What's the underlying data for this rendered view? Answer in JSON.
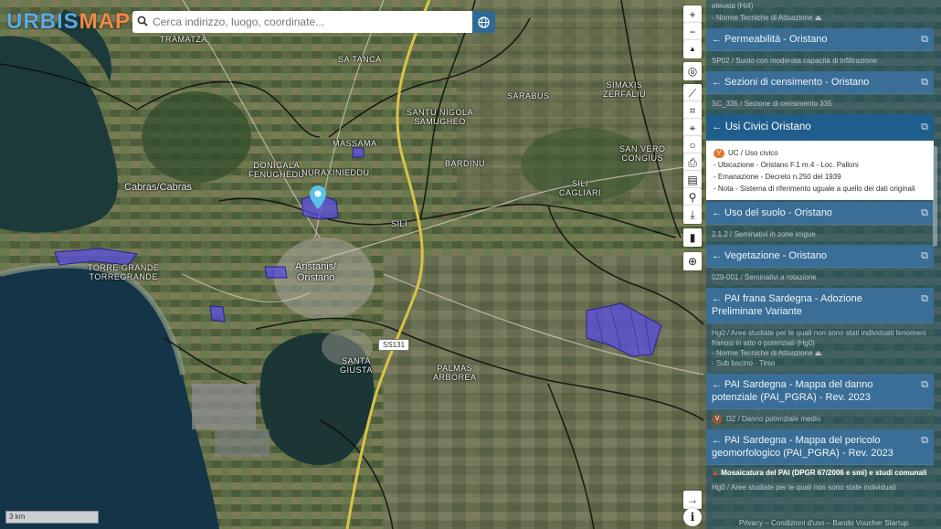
{
  "logo": {
    "part1": "URBIS",
    "part2": "MAP"
  },
  "search": {
    "placeholder": "Cerca indirizzo, luogo, coordinate..."
  },
  "map": {
    "labels": [
      {
        "id": "tabaccheria",
        "text": "TRAMATZA"
      },
      {
        "id": "sa-tanca",
        "text": "SA TANCA"
      },
      {
        "id": "massama",
        "text": "MASSAMA"
      },
      {
        "id": "donigala",
        "text": "DONIGALA\nFENUGHEDU"
      },
      {
        "id": "nuraxinieddu",
        "text": "NURAXINIEDDU"
      },
      {
        "id": "sarabus",
        "text": "SARABUS"
      },
      {
        "id": "simaxis",
        "text": "SIMAXIS\nZERFALIU"
      },
      {
        "id": "santu-nigola",
        "text": "SANTU NIGOLA\nSAMUGHEO"
      },
      {
        "id": "bardinu",
        "text": "BARDINU"
      },
      {
        "id": "san-vero",
        "text": "SAN VERO\nCONGIUS"
      },
      {
        "id": "solarussa",
        "text": "SILI\nCAGLIARI"
      },
      {
        "id": "silì",
        "text": "SILÌ"
      },
      {
        "id": "cabras",
        "text": "Cabras/Cabras"
      },
      {
        "id": "torre-grande",
        "text": "TORRE GRANDE\nTORREGRANDE"
      },
      {
        "id": "oristano",
        "text": "Aristanis/\nOristano"
      },
      {
        "id": "santa-giusta",
        "text": "SANTA\nGIUSTA"
      },
      {
        "id": "palmas",
        "text": "PALMAS\nARBOREA"
      }
    ],
    "road_badge": "SS131",
    "scale": "3 km"
  },
  "toolbar": {
    "zoom_in": "+",
    "zoom_out": "−",
    "north": "▲",
    "locate": "◎",
    "ruler": "⟋",
    "area": "⌗",
    "marker": "⌖",
    "circle": "○",
    "print": "⎙",
    "layers": "▤",
    "pin": "⚲",
    "download": "⤓",
    "bookmark": "▮",
    "language": "⊕",
    "collapse": "→",
    "info": "i"
  },
  "panel": {
    "top_text": "elevata (Hi4)",
    "top_note": "- Norme Tecniche di Attuazione",
    "sections": [
      {
        "id": "permeabilita",
        "title": "← Permeabilità - Oristano",
        "body": "SP02 / Suolo con moderata capacità di infiltrazione"
      },
      {
        "id": "censimento",
        "title": "← Sezioni di censimento - Oristano",
        "body": "SC_335 / Sezione di censimento 335"
      },
      {
        "id": "usi-civici",
        "title": "← Usi Civici Oristano",
        "badge": "V",
        "head_line": "UC / Uso civico",
        "rows": [
          "- Ubicazione - Oristano F.1 m.4 - Loc. Palloni",
          "- Emanazione - Decreto n.250 del 1939",
          "- Nota - Sistema di riferimento uguale a quello dei dati originali"
        ]
      },
      {
        "id": "uso-suolo",
        "title": "← Uso del suolo - Oristano",
        "body": "2.1.2 / Seminativi in zone irrigue"
      },
      {
        "id": "vegetazione",
        "title": "← Vegetazione - Oristano",
        "body": "029-001 / Seminativi a rotazione"
      },
      {
        "id": "pai-frana",
        "title": "← PAI frana Sardegna - Adozione Preliminare Variante",
        "body": "Hg0 / Aree studiate per le quali non sono stati individuati fenomeni franosi in atto o potenziali (Hg0)",
        "note1": "- Norme Tecniche di Attuazione",
        "note2": "- Sub bacino - Tirso"
      },
      {
        "id": "pai-danno",
        "title": "← PAI Sardegna - Mappa del danno potenziale (PAI_PGRA) - Rev. 2023",
        "badge": "V",
        "body": "D2 / Danno potenziale medio"
      },
      {
        "id": "pai-pericolo",
        "title": "← PAI Sardegna - Mappa del pericolo geomorfologico (PAI_PGRA) - Rev. 2023"
      }
    ],
    "warning": "Mosaicatura del PAI (DPGR 67/2006 e smi) e studi comunali",
    "bottom_text": "Hg0 / Aree studiate per le quali non sono state individuati",
    "footer": "Privacy – Condizioni d'uso – Bando Voucher Startup"
  },
  "colors": {
    "panel_head": "#3a6e96",
    "panel_active": "#1f5d8c",
    "accent_orange": "#e07830",
    "parcel": "#5b4fe0"
  }
}
